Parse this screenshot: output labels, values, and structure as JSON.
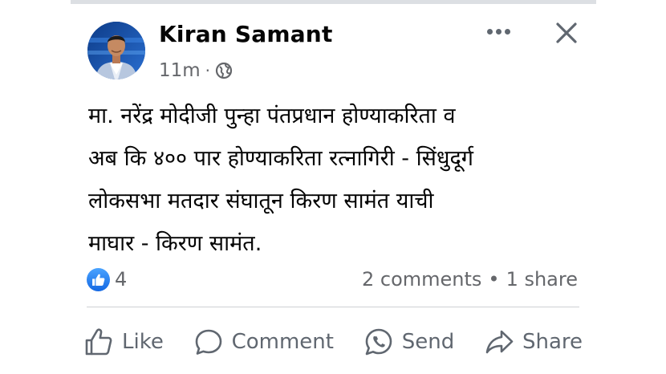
{
  "post": {
    "author": "Kiran Samant",
    "timestamp": "11m",
    "separator": "·",
    "audience_icon": "globe-icon",
    "text_lines": [
      "मा. नरेंद्र मोदीजी पुन्हा पंतप्रधान होण्याकरिता व",
      "अब कि ४०० पार होण्याकरिता रत्नागिरी - सिंधुदूर्ग",
      "लोकसभा मतदार संघातून किरण सामंत याची",
      "माघार  - किरण सामंत."
    ]
  },
  "reactions": {
    "icon": "like-reaction-icon",
    "count": "4"
  },
  "engagement": {
    "comments": "2 comments",
    "separator": "•",
    "shares": "1 share"
  },
  "actions": {
    "like": "Like",
    "comment": "Comment",
    "send": "Send",
    "share": "Share"
  },
  "colors": {
    "like_blue": "#1877f2",
    "secondary_text": "#65676b",
    "action_gray": "#606770",
    "primary_text": "#050505"
  }
}
